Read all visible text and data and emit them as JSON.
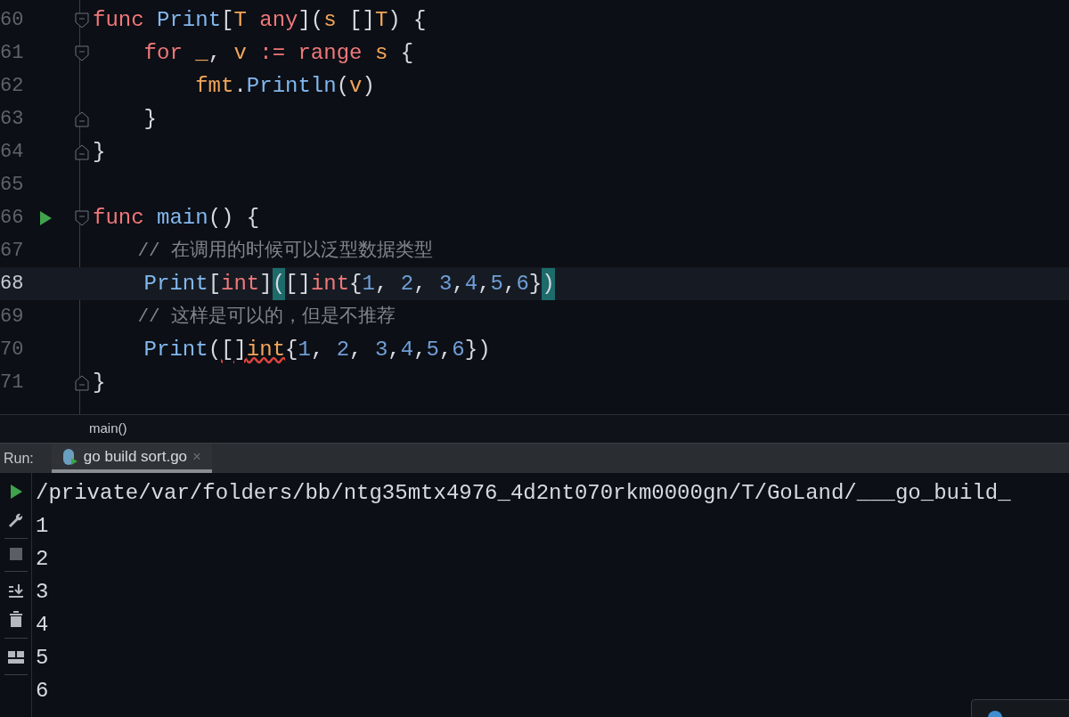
{
  "editor": {
    "lines": [
      {
        "number": "60",
        "fold_start": true,
        "fold_end": false,
        "runnable": false,
        "current": false,
        "tokens": [
          {
            "kind": "kw",
            "text": "func "
          },
          {
            "kind": "fn",
            "text": "Print"
          },
          {
            "kind": "plain",
            "text": "["
          },
          {
            "kind": "param",
            "text": "T "
          },
          {
            "kind": "kw",
            "text": "any"
          },
          {
            "kind": "plain",
            "text": "]("
          },
          {
            "kind": "param",
            "text": "s"
          },
          {
            "kind": "plain",
            "text": " []"
          },
          {
            "kind": "param",
            "text": "T"
          },
          {
            "kind": "plain",
            "text": ") {"
          }
        ]
      },
      {
        "number": "61",
        "fold_start": true,
        "fold_end": false,
        "runnable": false,
        "current": false,
        "tokens": [
          {
            "kind": "kw",
            "text": "    for "
          },
          {
            "kind": "param",
            "text": "_"
          },
          {
            "kind": "plain",
            "text": ", "
          },
          {
            "kind": "param",
            "text": "v "
          },
          {
            "kind": "kw",
            "text": ":= "
          },
          {
            "kind": "kw",
            "text": "range "
          },
          {
            "kind": "param",
            "text": "s"
          },
          {
            "kind": "plain",
            "text": " {"
          }
        ]
      },
      {
        "number": "62",
        "fold_start": false,
        "fold_end": false,
        "runnable": false,
        "current": false,
        "tokens": [
          {
            "kind": "param",
            "text": "        fmt"
          },
          {
            "kind": "plain",
            "text": "."
          },
          {
            "kind": "fn",
            "text": "Println"
          },
          {
            "kind": "plain",
            "text": "("
          },
          {
            "kind": "param",
            "text": "v"
          },
          {
            "kind": "plain",
            "text": ")"
          }
        ]
      },
      {
        "number": "63",
        "fold_start": false,
        "fold_end": true,
        "runnable": false,
        "current": false,
        "tokens": [
          {
            "kind": "plain",
            "text": "    }"
          }
        ]
      },
      {
        "number": "64",
        "fold_start": false,
        "fold_end": true,
        "runnable": false,
        "current": false,
        "tokens": [
          {
            "kind": "plain",
            "text": "}"
          }
        ]
      },
      {
        "number": "65",
        "fold_start": false,
        "fold_end": false,
        "runnable": false,
        "current": false
      },
      {
        "number": "66",
        "fold_start": true,
        "fold_end": false,
        "runnable": true,
        "current": false,
        "tokens": [
          {
            "kind": "kw",
            "text": "func "
          },
          {
            "kind": "fn",
            "text": "main"
          },
          {
            "kind": "plain",
            "text": "() {"
          }
        ]
      },
      {
        "number": "67",
        "fold_start": false,
        "fold_end": false,
        "runnable": false,
        "current": false,
        "tokens": [
          {
            "kind": "comment",
            "text": "    // 在调用的时候可以泛型数据类型"
          }
        ]
      },
      {
        "number": "68",
        "fold_start": false,
        "fold_end": false,
        "runnable": false,
        "current": true,
        "tokens": [
          {
            "kind": "fn",
            "text": "    Print"
          },
          {
            "kind": "plain",
            "text": "["
          },
          {
            "kind": "kw",
            "text": "int"
          },
          {
            "kind": "plain",
            "text": "]"
          },
          {
            "kind": "match",
            "text": "("
          },
          {
            "kind": "plain",
            "text": "[]"
          },
          {
            "kind": "kw",
            "text": "int"
          },
          {
            "kind": "plain",
            "text": "{"
          },
          {
            "kind": "num",
            "text": "1"
          },
          {
            "kind": "plain",
            "text": ", "
          },
          {
            "kind": "num",
            "text": "2"
          },
          {
            "kind": "plain",
            "text": ", "
          },
          {
            "kind": "num",
            "text": "3"
          },
          {
            "kind": "plain",
            "text": ","
          },
          {
            "kind": "num",
            "text": "4"
          },
          {
            "kind": "plain",
            "text": ","
          },
          {
            "kind": "num",
            "text": "5"
          },
          {
            "kind": "plain",
            "text": ","
          },
          {
            "kind": "num",
            "text": "6"
          },
          {
            "kind": "plain",
            "text": "}"
          },
          {
            "kind": "match",
            "text": ")"
          }
        ]
      },
      {
        "number": "69",
        "fold_start": false,
        "fold_end": false,
        "runnable": false,
        "current": false,
        "tokens": [
          {
            "kind": "comment",
            "text": "    // 这样是可以的，但是不推荐"
          }
        ]
      },
      {
        "number": "70",
        "fold_start": false,
        "fold_end": false,
        "runnable": false,
        "current": false,
        "tokens": [
          {
            "kind": "fn",
            "text": "    Print"
          },
          {
            "kind": "plain",
            "text": "("
          },
          {
            "kind": "error",
            "text": "[]"
          },
          {
            "kind": "error_type",
            "text": "int"
          },
          {
            "kind": "plain",
            "text": "{"
          },
          {
            "kind": "num",
            "text": "1"
          },
          {
            "kind": "plain",
            "text": ", "
          },
          {
            "kind": "num",
            "text": "2"
          },
          {
            "kind": "plain",
            "text": ", "
          },
          {
            "kind": "num",
            "text": "3"
          },
          {
            "kind": "plain",
            "text": ","
          },
          {
            "kind": "num",
            "text": "4"
          },
          {
            "kind": "plain",
            "text": ","
          },
          {
            "kind": "num",
            "text": "5"
          },
          {
            "kind": "plain",
            "text": ","
          },
          {
            "kind": "num",
            "text": "6"
          },
          {
            "kind": "plain",
            "text": "})"
          }
        ]
      },
      {
        "number": "71",
        "fold_start": false,
        "fold_end": true,
        "runnable": false,
        "current": false,
        "tokens": [
          {
            "kind": "plain",
            "text": "}"
          }
        ]
      }
    ]
  },
  "breadcrumb": "main()",
  "run_panel": {
    "label": "Run:",
    "tabs": [
      {
        "label": "go build sort.go",
        "close": "×",
        "selected": true
      }
    ],
    "console": [
      "/private/var/folders/bb/ntg35mtx4976_4d2nt070rkm0000gn/T/GoLand/___go_build_",
      "1",
      "2",
      "3",
      "4",
      "5",
      "6"
    ]
  }
}
